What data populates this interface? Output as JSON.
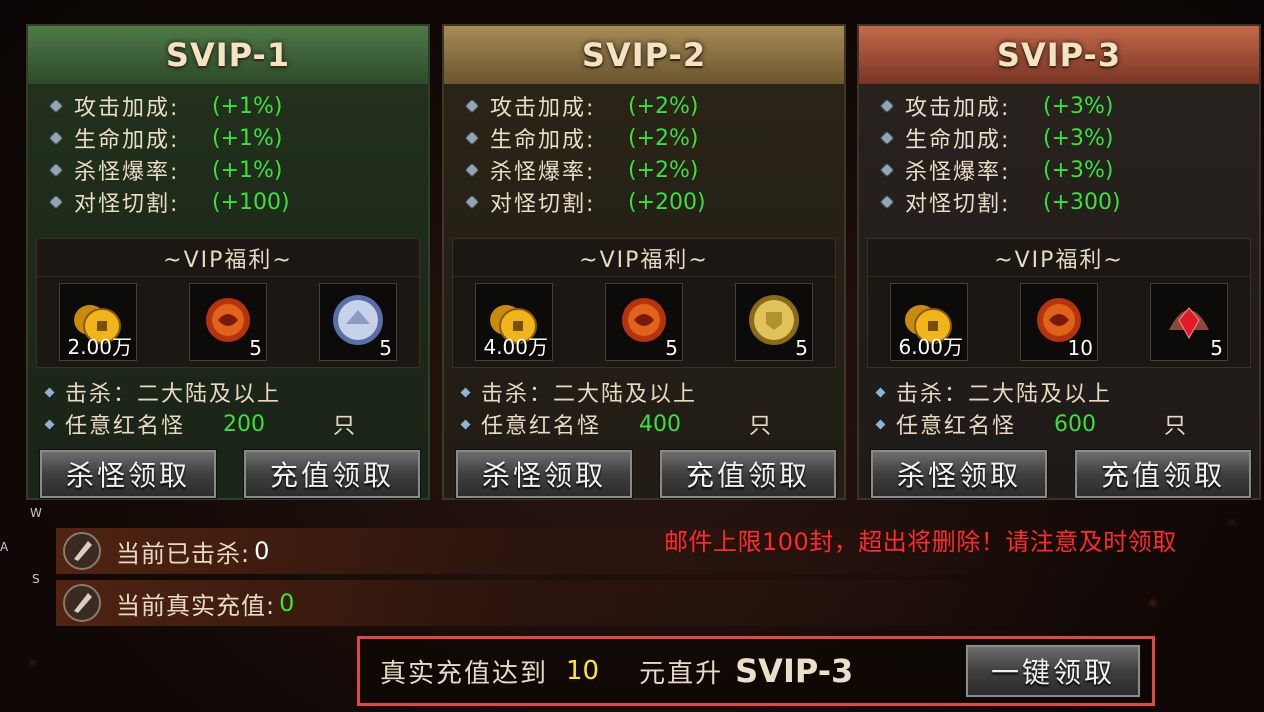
{
  "panels": [
    {
      "title": "SVIP-1",
      "stats": [
        {
          "label": "攻击加成:",
          "value": "(+1%)"
        },
        {
          "label": "生命加成:",
          "value": "(+1%)"
        },
        {
          "label": "杀怪爆率:",
          "value": "(+1%)"
        },
        {
          "label": "对怪切割:",
          "value": "(+100)"
        }
      ],
      "benefit_title": "~VIP福利~",
      "items": [
        {
          "icon": "gold-coins-icon",
          "count": "2.00万"
        },
        {
          "icon": "red-orb-icon",
          "count": "5"
        },
        {
          "icon": "silver-medal-icon",
          "count": "5"
        }
      ],
      "kill_label": "击杀：二大陆及以上",
      "red_label": "任意红名怪",
      "red_count": "200",
      "red_unit": "只",
      "btn_kill": "杀怪领取",
      "btn_recharge": "充值领取"
    },
    {
      "title": "SVIP-2",
      "stats": [
        {
          "label": "攻击加成:",
          "value": "(+2%)"
        },
        {
          "label": "生命加成:",
          "value": "(+2%)"
        },
        {
          "label": "杀怪爆率:",
          "value": "(+2%)"
        },
        {
          "label": "对怪切割:",
          "value": "(+200)"
        }
      ],
      "benefit_title": "~VIP福利~",
      "items": [
        {
          "icon": "gold-coins-icon",
          "count": "4.00万"
        },
        {
          "icon": "red-orb-icon",
          "count": "5"
        },
        {
          "icon": "gold-medal-icon",
          "count": "5"
        }
      ],
      "kill_label": "击杀：二大陆及以上",
      "red_label": "任意红名怪",
      "red_count": "400",
      "red_unit": "只",
      "btn_kill": "杀怪领取",
      "btn_recharge": "充值领取"
    },
    {
      "title": "SVIP-3",
      "stats": [
        {
          "label": "攻击加成:",
          "value": "(+3%)"
        },
        {
          "label": "生命加成:",
          "value": "(+3%)"
        },
        {
          "label": "杀怪爆率:",
          "value": "(+3%)"
        },
        {
          "label": "对怪切割:",
          "value": "(+300)"
        }
      ],
      "benefit_title": "~VIP福利~",
      "items": [
        {
          "icon": "gold-coins-icon",
          "count": "6.00万"
        },
        {
          "icon": "red-orb-icon",
          "count": "10"
        },
        {
          "icon": "ruby-crown-icon",
          "count": "5"
        }
      ],
      "kill_label": "击杀：二大陆及以上",
      "red_label": "任意红名怪",
      "red_count": "600",
      "red_unit": "只",
      "btn_kill": "杀怪领取",
      "btn_recharge": "充值领取"
    }
  ],
  "status": {
    "killed_label": "当前已击杀:",
    "killed_value": "0",
    "recharge_label": "当前真实充值:",
    "recharge_value": "0"
  },
  "notice": "邮件上限100封，超出将删除！请注意及时领取",
  "upgrade": {
    "text1": "真实充值达到",
    "amount": "10",
    "text2": "元直升",
    "level": "SVIP-3",
    "claim_label": "一键领取"
  },
  "side_letters": [
    "W",
    "A",
    "S"
  ],
  "colors": {
    "stat_value": "#3ce03c",
    "notice": "#ff2a2a",
    "amount": "#ffe23a",
    "highlight_border": "#e04848"
  }
}
